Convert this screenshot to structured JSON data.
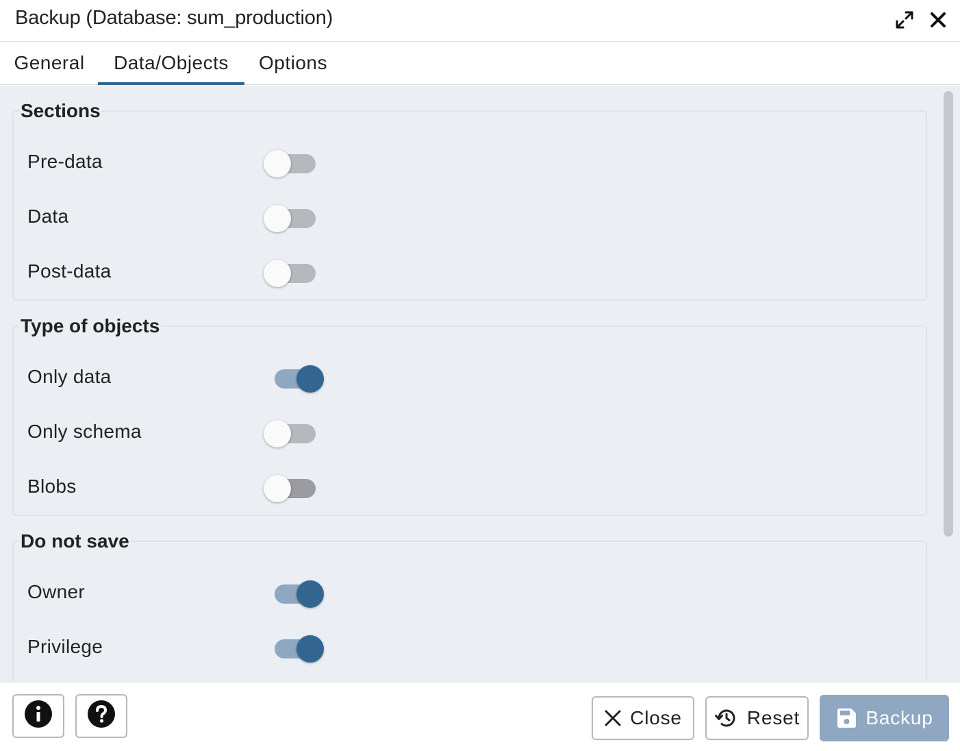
{
  "dialog": {
    "title": "Backup (Database: sum_production)"
  },
  "tabs": [
    {
      "label": "General",
      "active": false
    },
    {
      "label": "Data/Objects",
      "active": true
    },
    {
      "label": "Options",
      "active": false
    }
  ],
  "sections": {
    "title": "Sections",
    "items": [
      {
        "label": "Pre-data",
        "on": false
      },
      {
        "label": "Data",
        "on": false
      },
      {
        "label": "Post-data",
        "on": false
      }
    ]
  },
  "type_of_objects": {
    "title": "Type of objects",
    "items": [
      {
        "label": "Only data",
        "on": true
      },
      {
        "label": "Only schema",
        "on": false
      },
      {
        "label": "Blobs",
        "on": false
      }
    ]
  },
  "do_not_save": {
    "title": "Do not save",
    "items": [
      {
        "label": "Owner",
        "on": true
      },
      {
        "label": "Privilege",
        "on": true
      }
    ]
  },
  "footer": {
    "close_label": "Close",
    "reset_label": "Reset",
    "backup_label": "Backup"
  },
  "icons": {
    "expand": "expand-icon",
    "close": "close-icon",
    "info": "info-icon",
    "help": "help-icon",
    "reset": "reset-icon",
    "save": "save-icon"
  },
  "colors": {
    "accent": "#326690",
    "toggle_on_track": "#8fa7c0",
    "toggle_off_track": "#b5b8bd",
    "panel_bg": "#ebeef3",
    "backup_button_bg": "#8fa7c0"
  }
}
